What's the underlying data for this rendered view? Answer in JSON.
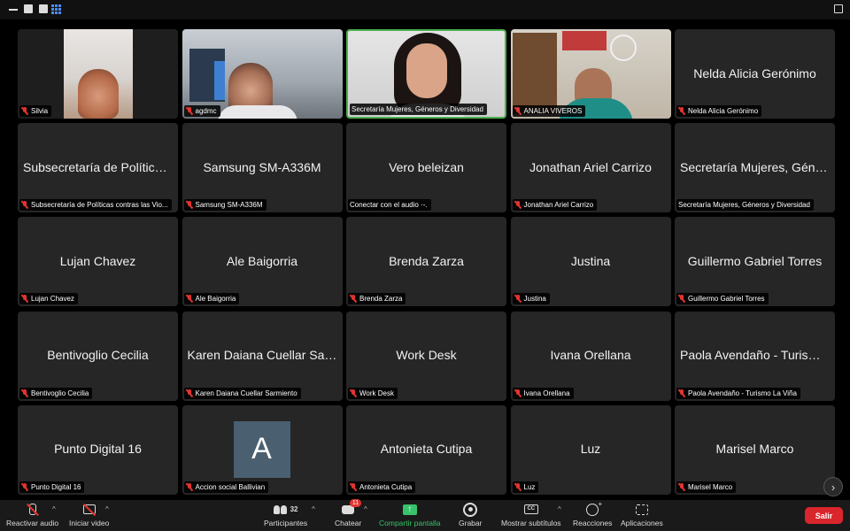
{
  "participants": [
    {
      "display": "",
      "nameplate": "Silvia",
      "muted": true,
      "video": "silvia"
    },
    {
      "display": "",
      "nameplate": "agdmc",
      "muted": true,
      "video": "agdmc"
    },
    {
      "display": "",
      "nameplate": "Secretaría Mujeres, Géneros y Diversidad",
      "muted": false,
      "video": "secre",
      "active": true
    },
    {
      "display": "",
      "nameplate": "ANALIA VIVEROS",
      "muted": true,
      "video": "analia"
    },
    {
      "display": "Nelda Alicia Gerónimo",
      "nameplate": "Nelda Alicia Gerónimo",
      "muted": true
    },
    {
      "display": "Subsecretaría de Políticas...",
      "nameplate": "Subsecretaría de Políticas contras las Vio...",
      "muted": true
    },
    {
      "display": "Samsung SM-A336M",
      "nameplate": "Samsung SM-A336M",
      "muted": true
    },
    {
      "display": "Vero beleizan",
      "nameplate": "Conectar con el audio ·-.",
      "muted": false
    },
    {
      "display": "Jonathan Ariel Carrizo",
      "nameplate": "Jonathan Ariel Carrizo",
      "muted": true
    },
    {
      "display": "Secretaría Mujeres, Géner...",
      "nameplate": "Secretaría Mujeres, Géneros y Diversidad",
      "muted": false
    },
    {
      "display": "Lujan Chavez",
      "nameplate": "Lujan Chavez",
      "muted": true
    },
    {
      "display": "Ale Baigorria",
      "nameplate": "Ale Baigorria",
      "muted": true
    },
    {
      "display": "Brenda Zarza",
      "nameplate": "Brenda Zarza",
      "muted": true
    },
    {
      "display": "Justina",
      "nameplate": "Justina",
      "muted": true
    },
    {
      "display": "Guillermo Gabriel Torres",
      "nameplate": "Guillermo Gabriel Torres",
      "muted": true
    },
    {
      "display": "Bentivoglio Cecilia",
      "nameplate": "Bentivoglio Cecilia",
      "muted": true
    },
    {
      "display": "Karen Daiana Cuellar Sar...",
      "nameplate": "Karen Daiana Cuellar Sarmiento",
      "muted": true
    },
    {
      "display": "Work Desk",
      "nameplate": "Work Desk",
      "muted": true
    },
    {
      "display": "Ivana Orellana",
      "nameplate": "Ivana Orellana",
      "muted": true
    },
    {
      "display": "Paola Avendaño - Turismo...",
      "nameplate": "Paola Avendaño - Turismo La Viña",
      "muted": true
    },
    {
      "display": "Punto Digital 16",
      "nameplate": "Punto Digital 16",
      "muted": true
    },
    {
      "display": "",
      "nameplate": "Accion social Ballivian",
      "muted": true,
      "avatar": "A"
    },
    {
      "display": "Antonieta Cutipa",
      "nameplate": "Antonieta Cutipa",
      "muted": true
    },
    {
      "display": "Luz",
      "nameplate": "Luz",
      "muted": true
    },
    {
      "display": "Marisel Marco",
      "nameplate": "Marisel Marco",
      "muted": true
    }
  ],
  "toolbar": {
    "unmute_label": "Reactivar audio",
    "start_video_label": "Iniciar video",
    "participants_label": "Participantes",
    "participants_count": "32",
    "chat_label": "Chatear",
    "chat_badge": "11",
    "share_label": "Compartir pantalla",
    "record_label": "Grabar",
    "captions_label": "Mostrar subtítulos",
    "captions_icon_text": "CC",
    "reactions_label": "Reacciones",
    "apps_label": "Aplicaciones",
    "leave_label": "Salir"
  },
  "colors": {
    "active_speaker": "#4caf50",
    "muted_icon": "#e3342f",
    "leave_button": "#d9262d",
    "share_green": "#39c26b",
    "avatar_bg": "#4a5f70"
  },
  "icons": {
    "next_page": "›",
    "caret": "^",
    "share_arrow": "↑"
  }
}
